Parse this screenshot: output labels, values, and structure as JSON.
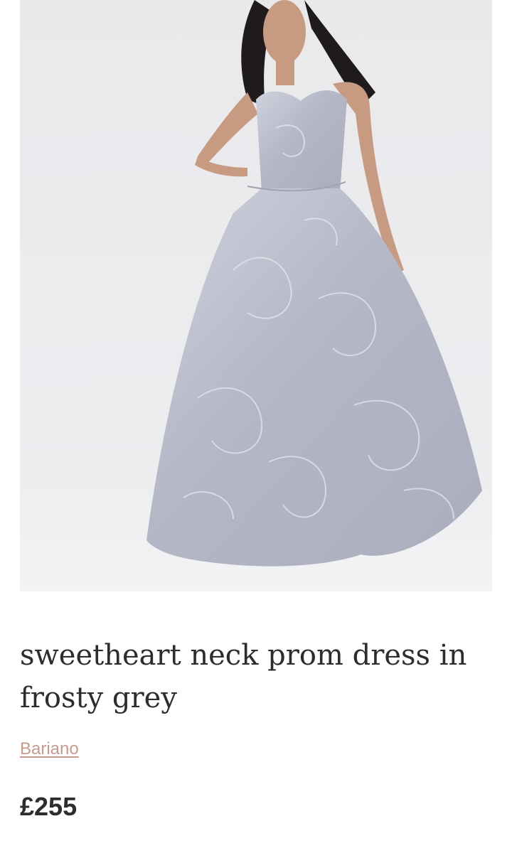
{
  "product": {
    "image_alt": "sweetheart neck prom dress in frosty grey",
    "title": "sweetheart neck prom dress in frosty grey",
    "brand": "Bariano",
    "price": "£255"
  },
  "colors": {
    "text": "#2d2d2d",
    "brand_link": "#c69a8d",
    "dress": "#b8bcc9",
    "background": "#ededf0"
  },
  "icons": []
}
